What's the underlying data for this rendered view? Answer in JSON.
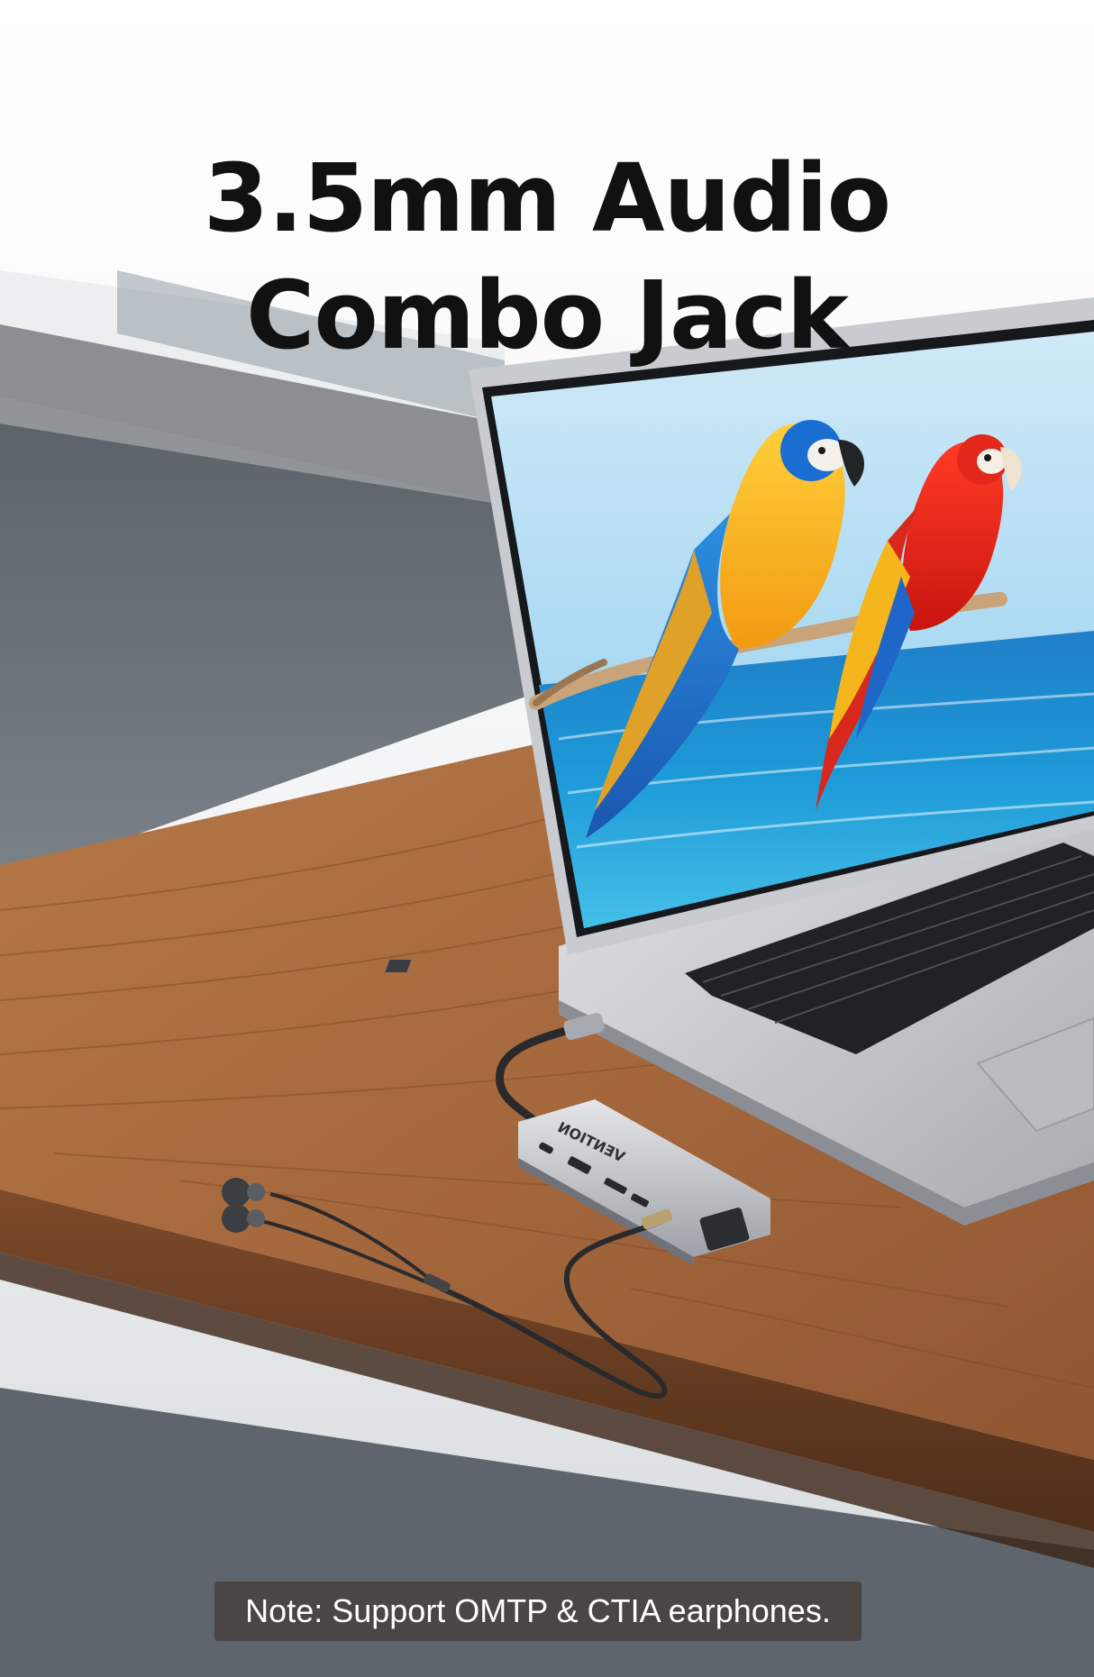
{
  "headline": {
    "line1": "3.5mm Audio",
    "line2": "Combo Jack"
  },
  "hub_brand": "VENTION",
  "note": "Note: Support OMTP & CTIA earphones.",
  "colors": {
    "background": "#ffffff",
    "headline": "#111111",
    "desk_wood": "#a86a3f",
    "laptop_silver": "#c9ccd1",
    "sea_blue": "#1e8fd6",
    "note_bg": "#463e38"
  }
}
